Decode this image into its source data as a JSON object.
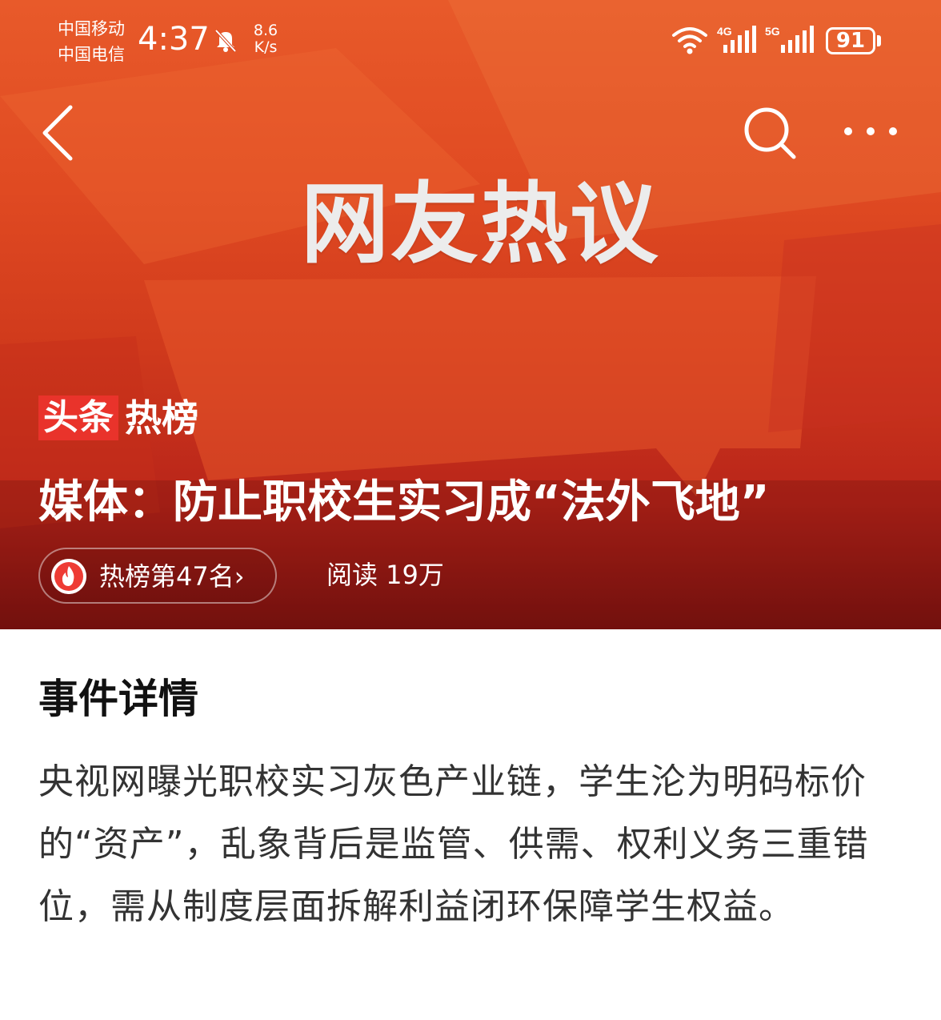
{
  "status_bar": {
    "carrier1": "中国移动",
    "carrier2": "中国电信",
    "time": "4:37",
    "speed_value": "8.6",
    "speed_unit": "K/s",
    "signal1": "4G",
    "signal2": "5G",
    "battery": "91"
  },
  "nav": {
    "back_icon": "chevron-left-icon",
    "search_icon": "search-icon",
    "more_icon": "more-dots-icon"
  },
  "hero": {
    "banner_text": "网友热议",
    "brand_box": "头条",
    "brand_hot": "热榜",
    "headline": "媒体：防止职校生实习成“法外飞地”",
    "rank_label": "热榜第47名",
    "rank_arrow": "›",
    "reads": "阅读 19万"
  },
  "detail": {
    "title": "事件详情",
    "summary": "央视网曝光职校实习灰色产业链，学生沦为明码标价的“资产”，乱象背后是监管、供需、权利义务三重错位，需从制度层面拆解利益闭环保障学生权益。"
  },
  "colors": {
    "brand_red": "#e9332b",
    "hero_top": "#e85a2a",
    "hero_bottom": "#7a1210"
  }
}
